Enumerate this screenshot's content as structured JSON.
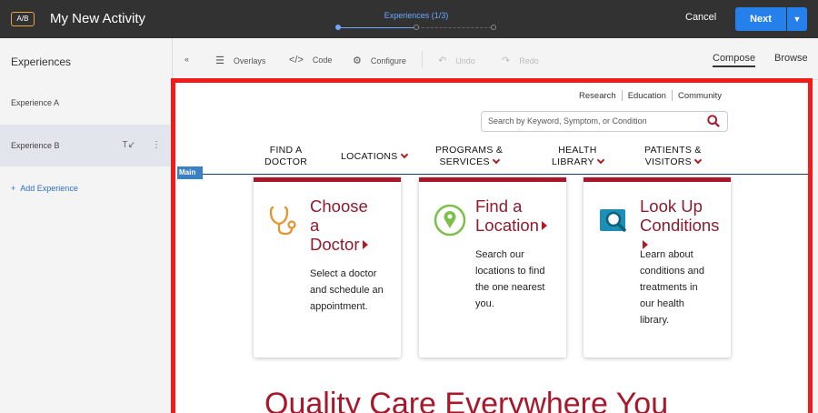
{
  "topbar": {
    "badge": "A/B",
    "title": "My New Activity",
    "progress_label": "Experiences (1/3)",
    "cancel_label": "Cancel",
    "next_label": "Next"
  },
  "left_panel": {
    "title": "Experiences",
    "experiences": [
      {
        "label": "Experience A",
        "selected": false
      },
      {
        "label": "Experience B",
        "selected": true
      }
    ],
    "add_label": "Add Experience"
  },
  "toolbar": {
    "overlays_label": "Overlays",
    "code_label": "Code",
    "configure_label": "Configure",
    "undo_label": "Undo",
    "redo_label": "Redo",
    "compose_label": "Compose",
    "browse_label": "Browse"
  },
  "site": {
    "utility_links": [
      "Research",
      "Education",
      "Community"
    ],
    "search_placeholder": "Search by Keyword, Symptom, or Condition",
    "main_tag": "Main",
    "nav": [
      {
        "line1": "FIND A",
        "line2": "DOCTOR",
        "dropdown": false
      },
      {
        "line1": "LOCATIONS",
        "line2": "",
        "dropdown": true
      },
      {
        "line1": "PROGRAMS &",
        "line2": "SERVICES",
        "dropdown": true
      },
      {
        "line1": "HEALTH",
        "line2": "LIBRARY",
        "dropdown": true
      },
      {
        "line1": "PATIENTS &",
        "line2": "VISITORS",
        "dropdown": true
      }
    ],
    "cards": [
      {
        "title_lines": [
          "Choose",
          "a",
          "Doctor"
        ],
        "desc_lines": [
          "Select a doctor",
          "and schedule an",
          "appointment."
        ],
        "icon": "stethoscope-icon"
      },
      {
        "title_lines": [
          "Find a",
          "Location"
        ],
        "desc_lines": [
          "Search our",
          "locations to find",
          "the one nearest",
          "you."
        ],
        "icon": "location-pin-icon"
      },
      {
        "title_lines": [
          "Look Up",
          "Conditions"
        ],
        "desc_lines": [
          "Learn about",
          "conditions and",
          "treatments in",
          "our health",
          "library."
        ],
        "icon": "magnifier-document-icon"
      }
    ],
    "headline": "Quality Care Everywhere You"
  },
  "colors": {
    "topbar_bg": "#323232",
    "accent_blue": "#2680eb",
    "highlight_red": "#f51a1a",
    "brand_red": "#a8172a"
  }
}
